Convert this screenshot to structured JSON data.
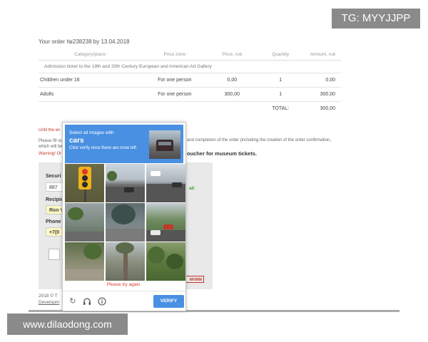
{
  "order": {
    "title": "Your order №238238 by 13.04.2018",
    "headers": [
      "Category/place",
      "Price zone",
      "Price, rub",
      "Quantity",
      "Amount, rub"
    ],
    "subheader": "Admission ticket to the 19th and 20th Century European and American Art Gallery",
    "rows": [
      {
        "category": "Children under 16",
        "zone": "For one person",
        "price": "0,00",
        "qty": "1",
        "amount": "0,00"
      },
      {
        "category": "Adults",
        "zone": "For one person",
        "price": "300,00",
        "qty": "1",
        "amount": "300,00"
      }
    ],
    "total_label": "TOTAL:",
    "total_value": "300,00"
  },
  "notices": {
    "until": "Until the en",
    "please": "Please fill ou which will be",
    "completion": "and completion of the order (including the creation of the order confirmation,",
    "warning": "Warning! Or",
    "voucher": "oucher for museum tickets."
  },
  "form": {
    "security_label": "Securi",
    "security_value": "887 ",
    "recipient_label": "Recipie",
    "recipient_value": "Ron V",
    "phone_label": "Phone",
    "phone_value": "+7(0",
    "green_text": "ail",
    "confirm_label": "NFIRM"
  },
  "footer": {
    "copyright": "2018 © T",
    "developer": "Developm"
  },
  "captcha": {
    "line1": "Select all images with",
    "word": "cars",
    "line3": "Click verify once there are none left",
    "error": "Please try again.",
    "verify_label": "VERIFY",
    "icons": [
      "refresh-icon",
      "headphones-icon",
      "info-icon"
    ]
  },
  "overlays": {
    "tg_tag": "TG: MYYJJPP",
    "watermark": "www.dilaodong.com"
  }
}
